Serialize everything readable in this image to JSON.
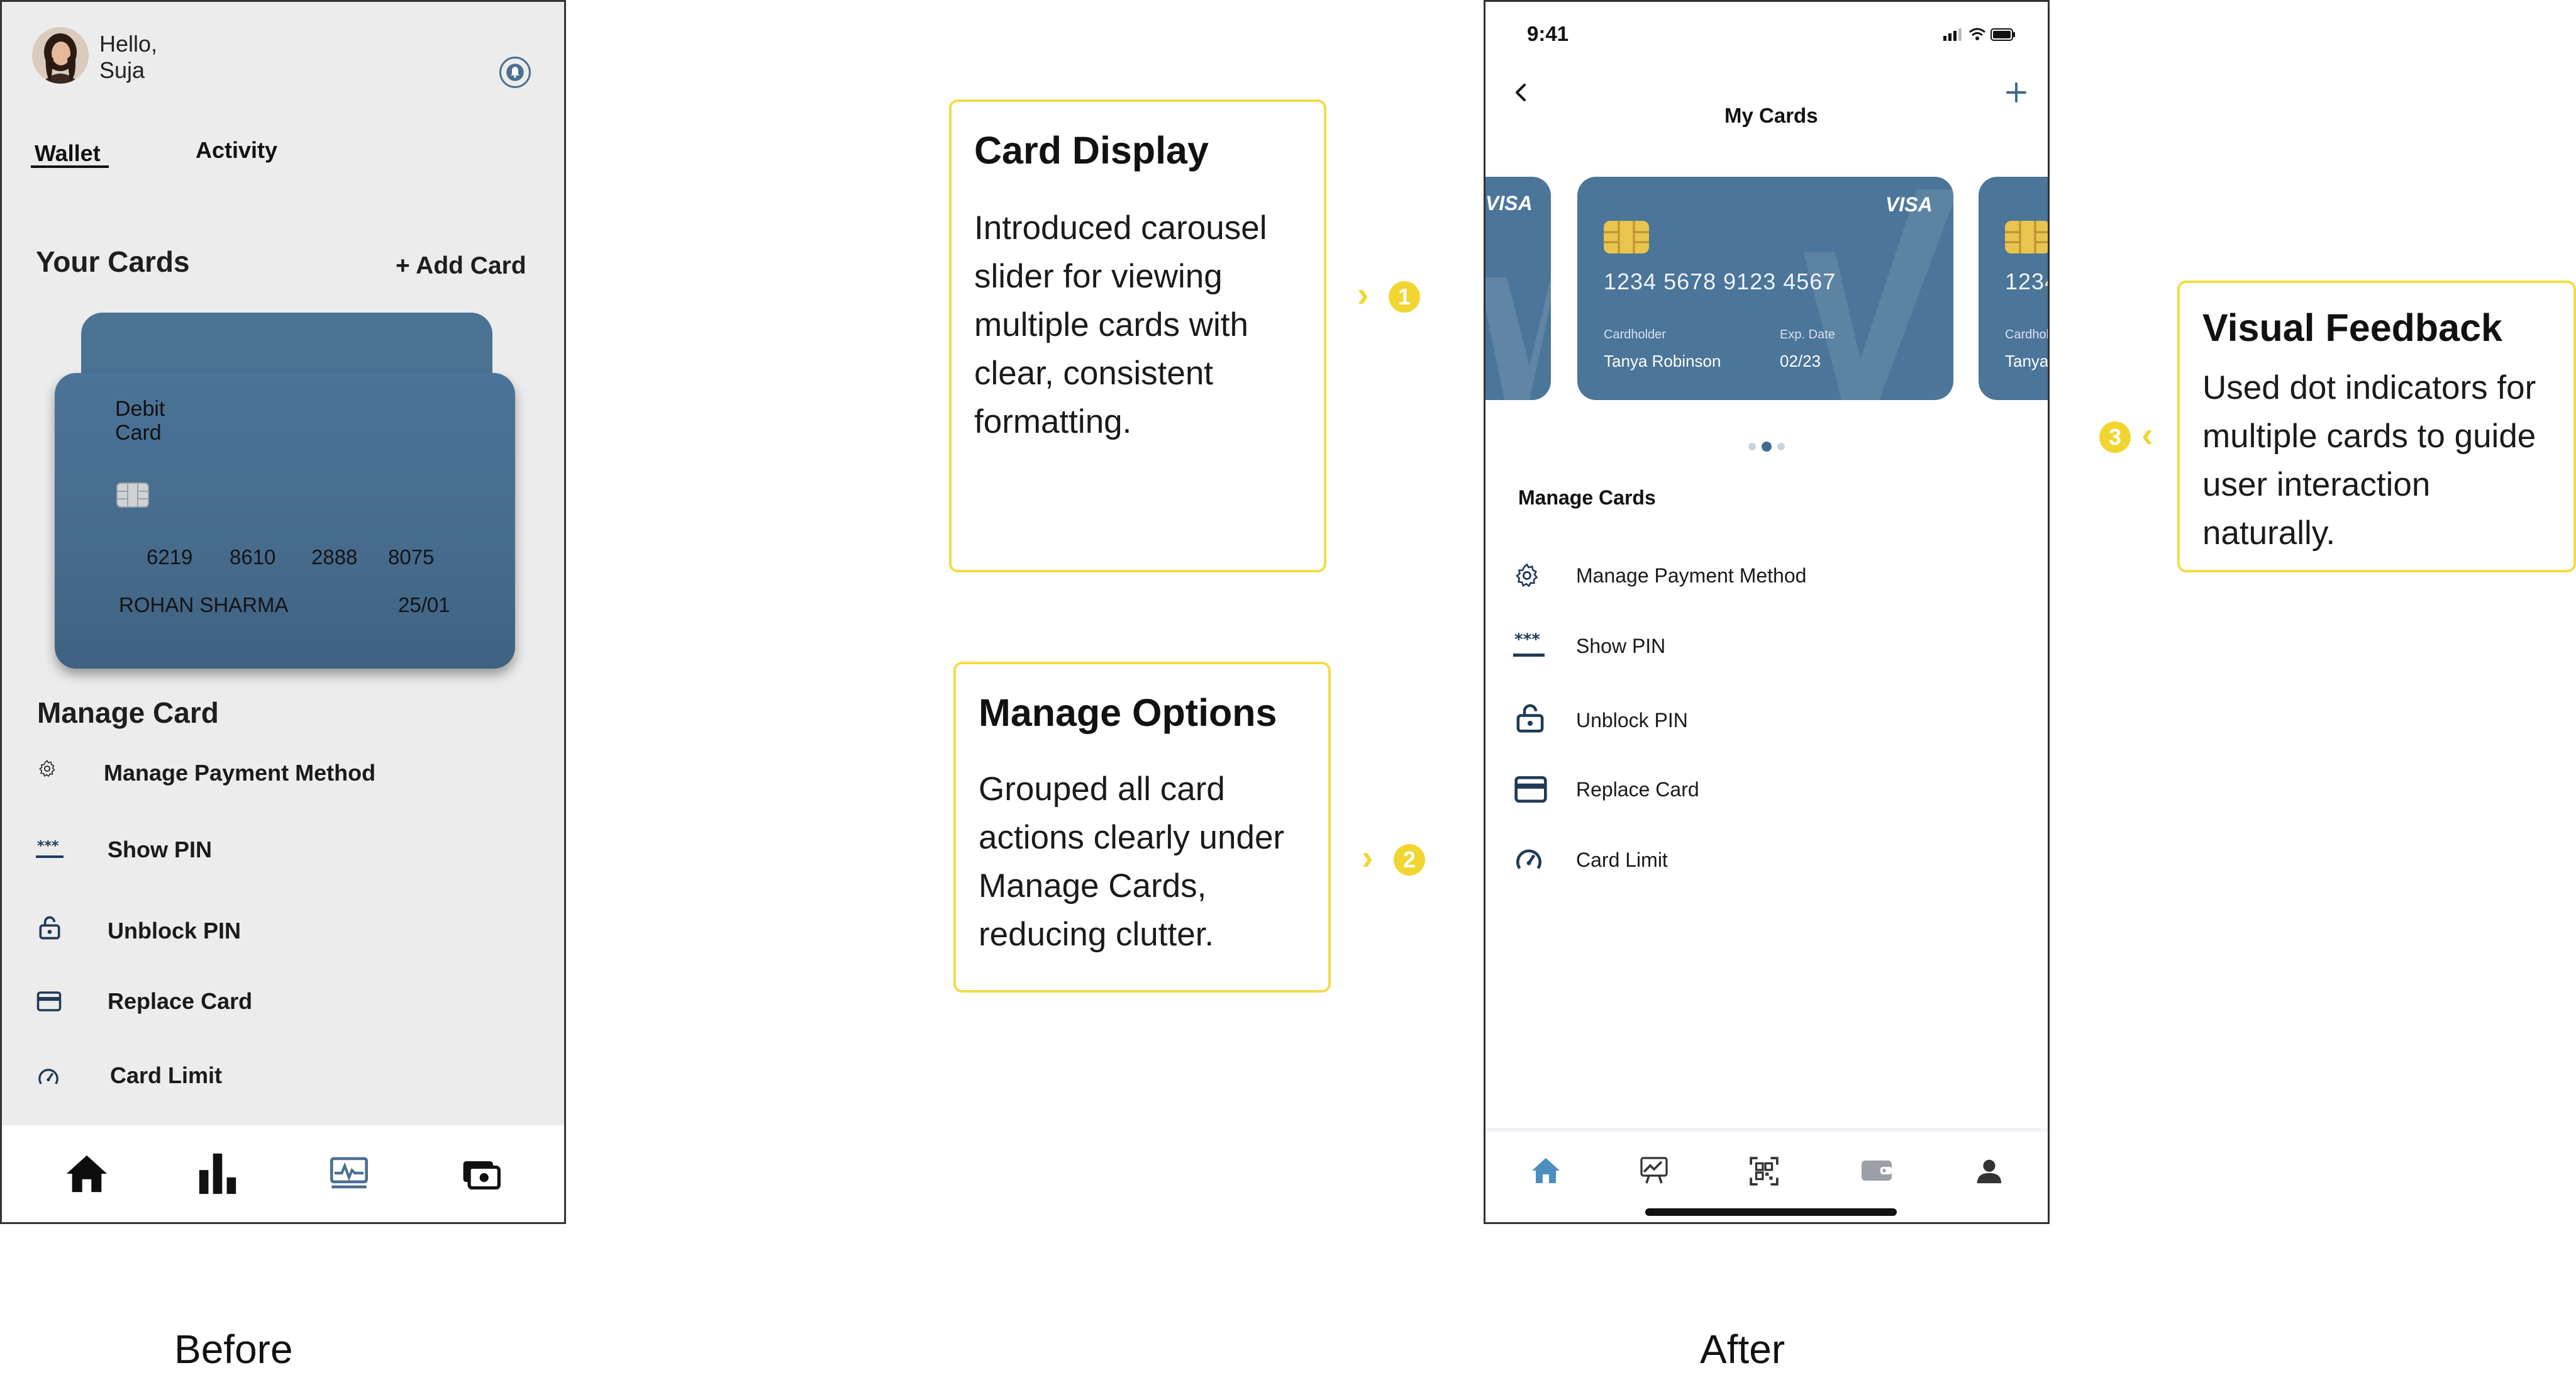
{
  "before": {
    "greeting_line1": "Hello,",
    "greeting_line2": "Suja",
    "tabs": [
      {
        "label": "Wallet",
        "active": true
      },
      {
        "label": "Activity",
        "active": false
      }
    ],
    "your_cards_title": "Your Cards",
    "add_card_label": "+ Add Card",
    "card": {
      "type_line1": "Debit",
      "type_line2": "Card",
      "number_groups": [
        "6219",
        "8610",
        "2888",
        "8075"
      ],
      "holder": "ROHAN SHARMA",
      "expiry": "25/01"
    },
    "manage_title": "Manage Card",
    "menu": [
      {
        "label": "Manage Payment Method",
        "icon": "gear-icon"
      },
      {
        "label": "Show PIN",
        "icon": "pin-icon"
      },
      {
        "label": "Unblock PIN",
        "icon": "lock-icon"
      },
      {
        "label": "Replace Card",
        "icon": "card-icon"
      },
      {
        "label": "Card Limit",
        "icon": "gauge-icon"
      }
    ],
    "bottom_nav": [
      "home-icon",
      "bar-chart-icon",
      "activity-icon",
      "wallet-icon"
    ],
    "caption": "Before"
  },
  "callouts": [
    {
      "number": "1",
      "title": "Card Display",
      "lines": [
        "Introduced carousel",
        "slider for viewing",
        "multiple cards with",
        "clear, consistent",
        "formatting."
      ]
    },
    {
      "number": "2",
      "title": "Manage Options",
      "lines": [
        "Grouped all card",
        "actions clearly under",
        "Manage Cards,",
        "reducing clutter."
      ]
    },
    {
      "number": "3",
      "title": "Visual Feedback",
      "lines": [
        "Used dot indicators for",
        "multiple cards to guide",
        "user interaction",
        "naturally."
      ]
    }
  ],
  "after": {
    "status_time": "9:41",
    "title": "My Cards",
    "cards": {
      "left_logo": "VISA",
      "center": {
        "logo": "VISA",
        "number": "1234  5678  9123  4567",
        "holder_label": "Cardholder",
        "holder": "Tanya Robinson",
        "exp_label": "Exp. Date",
        "exp": "02/23"
      },
      "right": {
        "number": "1234",
        "holder_label": "Cardhol",
        "holder": "Tanya"
      }
    },
    "dots_active_index": 1,
    "manage_title": "Manage Cards",
    "menu": [
      {
        "label": "Manage Payment Method",
        "icon": "gear-icon"
      },
      {
        "label": "Show PIN",
        "icon": "pin-icon"
      },
      {
        "label": "Unblock PIN",
        "icon": "lock-icon"
      },
      {
        "label": "Replace Card",
        "icon": "card-icon"
      },
      {
        "label": "Card Limit",
        "icon": "gauge-icon"
      }
    ],
    "bottom_nav": [
      "home-icon",
      "chart-icon",
      "qr-icon",
      "wallet-icon",
      "profile-icon"
    ],
    "caption": "After"
  },
  "colors": {
    "accent": "#f1d631",
    "card": "#4b7599",
    "nav_active": "#4a8fc0"
  }
}
